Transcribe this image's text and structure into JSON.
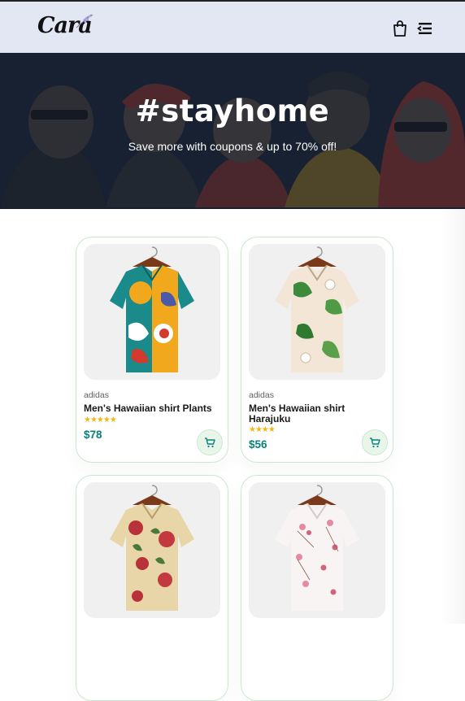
{
  "header": {
    "logo_text": "Cara",
    "bag_icon": "shopping-bag-icon",
    "menu_icon": "menu-icon"
  },
  "hero": {
    "title": "#stayhome",
    "subtitle": "Save more with coupons & up to 70% off!"
  },
  "colors": {
    "header_bg": "#e3e6f3",
    "accent": "#088178",
    "star": "#f3b519",
    "card_border": "#cce7d0",
    "hero_bg": "#1f2a3a"
  },
  "products": [
    {
      "brand": "adidas",
      "name": "Men's Hawaiian shirt Plants",
      "rating": 5,
      "stars": "★★★★★",
      "price": "$78",
      "cart_icon": "cart-icon"
    },
    {
      "brand": "adidas",
      "name": "Men's Hawaiian shirt Harajuku",
      "rating": 4,
      "stars": "★★★★",
      "price": "$56",
      "cart_icon": "cart-icon"
    },
    {
      "brand": "",
      "name": "",
      "price": ""
    },
    {
      "brand": "",
      "name": "",
      "price": ""
    }
  ]
}
